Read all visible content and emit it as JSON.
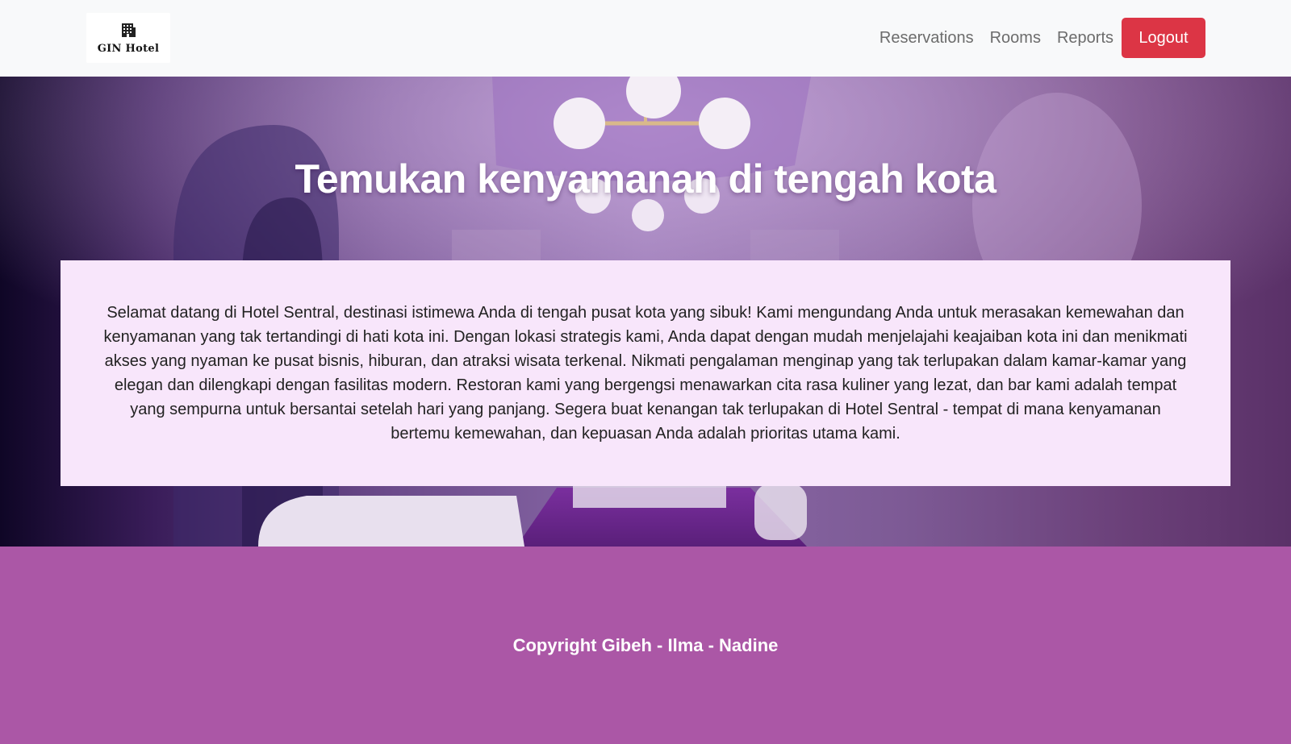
{
  "navbar": {
    "logo": {
      "icon": "hotel-building-icon",
      "text": "GIN Hotel"
    },
    "links": [
      {
        "label": "Reservations"
      },
      {
        "label": "Rooms"
      },
      {
        "label": "Reports"
      }
    ],
    "logout_label": "Logout"
  },
  "hero": {
    "title": "Temukan kenyamanan di tengah kota",
    "welcome_text": "Selamat datang di Hotel Sentral, destinasi istimewa Anda di tengah pusat kota yang sibuk! Kami mengundang Anda untuk merasakan kemewahan dan kenyamanan yang tak tertandingi di hati kota ini. Dengan lokasi strategis kami, Anda dapat dengan mudah menjelajahi keajaiban kota ini dan menikmati akses yang nyaman ke pusat bisnis, hiburan, dan atraksi wisata terkenal. Nikmati pengalaman menginap yang tak terlupakan dalam kamar-kamar yang elegan dan dilengkapi dengan fasilitas modern. Restoran kami yang bergengsi menawarkan cita rasa kuliner yang lezat, dan bar kami adalah tempat yang sempurna untuk bersantai setelah hari yang panjang. Segera buat kenangan tak terlupakan di Hotel Sentral - tempat di mana kenyamanan bertemu kemewahan, dan kepuasan Anda adalah prioritas utama kami."
  },
  "footer": {
    "copyright": "Copyright Gibeh - Ilma - Nadine"
  },
  "colors": {
    "navbar_bg": "#f8f9fa",
    "logout_bg": "#dc3545",
    "welcome_box_bg": "#f8e6fb",
    "footer_bg": "#ab57a6"
  }
}
